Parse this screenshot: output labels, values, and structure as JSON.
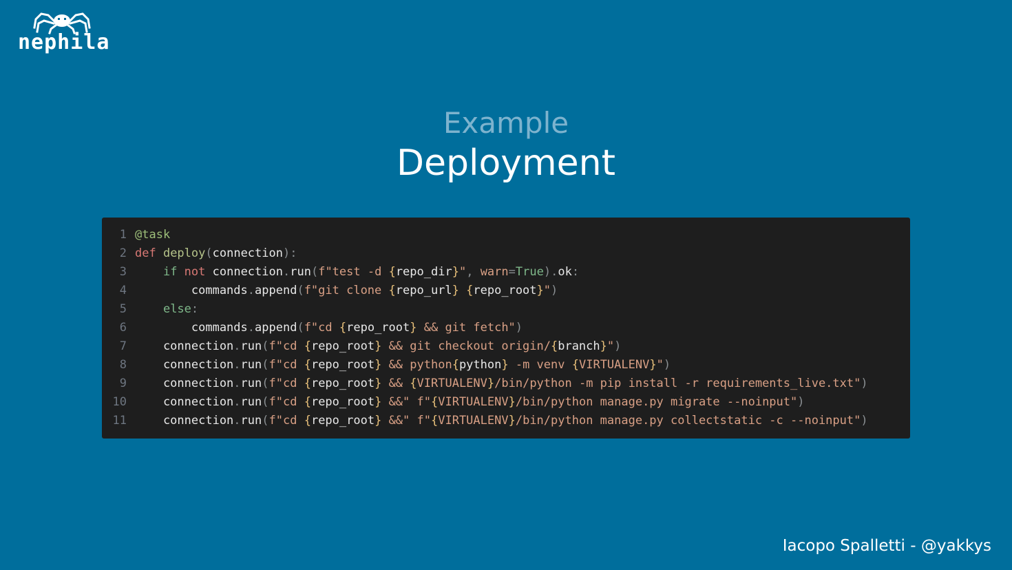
{
  "logo": {
    "wordmark": "nephila",
    "icon": "spider-icon"
  },
  "slide": {
    "subtitle": "Example",
    "title": "Deployment"
  },
  "code": {
    "lines": [
      [
        [
          "dec",
          "@task"
        ]
      ],
      [
        [
          "kw",
          "def "
        ],
        [
          "fn",
          "deploy"
        ],
        [
          "punc",
          "("
        ],
        [
          "id",
          "connection"
        ],
        [
          "punc",
          "):"
        ]
      ],
      [
        [
          "id",
          "    "
        ],
        [
          "kw2",
          "if "
        ],
        [
          "kw",
          "not "
        ],
        [
          "id",
          "connection"
        ],
        [
          "punc",
          "."
        ],
        [
          "id",
          "run"
        ],
        [
          "punc",
          "("
        ],
        [
          "str",
          "f\"test -d "
        ],
        [
          "brace",
          "{"
        ],
        [
          "id",
          "repo_dir"
        ],
        [
          "brace",
          "}"
        ],
        [
          "str",
          "\""
        ],
        [
          "punc",
          ", "
        ],
        [
          "param",
          "warn"
        ],
        [
          "punc",
          "="
        ],
        [
          "kw2",
          "True"
        ],
        [
          "punc",
          ")"
        ],
        [
          "punc",
          "."
        ],
        [
          "id",
          "ok"
        ],
        [
          "punc",
          ":"
        ]
      ],
      [
        [
          "id",
          "        commands"
        ],
        [
          "punc",
          "."
        ],
        [
          "id",
          "append"
        ],
        [
          "punc",
          "("
        ],
        [
          "str",
          "f\"git clone "
        ],
        [
          "brace",
          "{"
        ],
        [
          "id",
          "repo_url"
        ],
        [
          "brace",
          "}"
        ],
        [
          "str",
          " "
        ],
        [
          "brace",
          "{"
        ],
        [
          "id",
          "repo_root"
        ],
        [
          "brace",
          "}"
        ],
        [
          "str",
          "\""
        ],
        [
          "punc",
          ")"
        ]
      ],
      [
        [
          "id",
          "    "
        ],
        [
          "kw2",
          "else"
        ],
        [
          "punc",
          ":"
        ]
      ],
      [
        [
          "id",
          "        commands"
        ],
        [
          "punc",
          "."
        ],
        [
          "id",
          "append"
        ],
        [
          "punc",
          "("
        ],
        [
          "str",
          "f\"cd "
        ],
        [
          "brace",
          "{"
        ],
        [
          "id",
          "repo_root"
        ],
        [
          "brace",
          "}"
        ],
        [
          "str",
          " && git fetch\""
        ],
        [
          "punc",
          ")"
        ]
      ],
      [
        [
          "id",
          "    connection"
        ],
        [
          "punc",
          "."
        ],
        [
          "id",
          "run"
        ],
        [
          "punc",
          "("
        ],
        [
          "str",
          "f\"cd "
        ],
        [
          "brace",
          "{"
        ],
        [
          "id",
          "repo_root"
        ],
        [
          "brace",
          "}"
        ],
        [
          "str",
          " && git checkout origin/"
        ],
        [
          "brace",
          "{"
        ],
        [
          "id",
          "branch"
        ],
        [
          "brace",
          "}"
        ],
        [
          "str",
          "\""
        ],
        [
          "punc",
          ")"
        ]
      ],
      [
        [
          "id",
          "    connection"
        ],
        [
          "punc",
          "."
        ],
        [
          "id",
          "run"
        ],
        [
          "punc",
          "("
        ],
        [
          "str",
          "f\"cd "
        ],
        [
          "brace",
          "{"
        ],
        [
          "id",
          "repo_root"
        ],
        [
          "brace",
          "}"
        ],
        [
          "str",
          " && python"
        ],
        [
          "brace",
          "{"
        ],
        [
          "id",
          "python"
        ],
        [
          "brace",
          "}"
        ],
        [
          "str",
          " -m venv "
        ],
        [
          "brace",
          "{"
        ],
        [
          "str",
          "VIRTUALENV"
        ],
        [
          "brace",
          "}"
        ],
        [
          "str",
          "\""
        ],
        [
          "punc",
          ")"
        ]
      ],
      [
        [
          "id",
          "    connection"
        ],
        [
          "punc",
          "."
        ],
        [
          "id",
          "run"
        ],
        [
          "punc",
          "("
        ],
        [
          "str",
          "f\"cd "
        ],
        [
          "brace",
          "{"
        ],
        [
          "id",
          "repo_root"
        ],
        [
          "brace",
          "}"
        ],
        [
          "str",
          " && "
        ],
        [
          "brace",
          "{"
        ],
        [
          "str",
          "VIRTUALENV"
        ],
        [
          "brace",
          "}"
        ],
        [
          "str",
          "/bin/python -m pip install -r requirements_live.txt\""
        ],
        [
          "punc",
          ")"
        ]
      ],
      [
        [
          "id",
          "    connection"
        ],
        [
          "punc",
          "."
        ],
        [
          "id",
          "run"
        ],
        [
          "punc",
          "("
        ],
        [
          "str",
          "f\"cd "
        ],
        [
          "brace",
          "{"
        ],
        [
          "id",
          "repo_root"
        ],
        [
          "brace",
          "}"
        ],
        [
          "str",
          " &&\" f\""
        ],
        [
          "brace",
          "{"
        ],
        [
          "str",
          "VIRTUALENV"
        ],
        [
          "brace",
          "}"
        ],
        [
          "str",
          "/bin/python manage.py migrate --noinput\""
        ],
        [
          "punc",
          ")"
        ]
      ],
      [
        [
          "id",
          "    connection"
        ],
        [
          "punc",
          "."
        ],
        [
          "id",
          "run"
        ],
        [
          "punc",
          "("
        ],
        [
          "str",
          "f\"cd "
        ],
        [
          "brace",
          "{"
        ],
        [
          "id",
          "repo_root"
        ],
        [
          "brace",
          "}"
        ],
        [
          "str",
          " &&\" f\""
        ],
        [
          "brace",
          "{"
        ],
        [
          "str",
          "VIRTUALENV"
        ],
        [
          "brace",
          "}"
        ],
        [
          "str",
          "/bin/python manage.py collectstatic -c --noinput\""
        ],
        [
          "punc",
          ")"
        ]
      ]
    ]
  },
  "footer": {
    "credit": "Iacopo Spalletti - @yakkys"
  }
}
